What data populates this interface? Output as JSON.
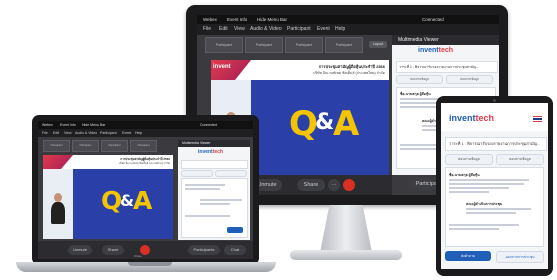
{
  "monitor": {
    "title": {
      "app": "Webex",
      "event_info": "Event Info",
      "hide_menu": "Hide Menu Bar",
      "connected": "Connected"
    },
    "menu": [
      "File",
      "Edit",
      "View",
      "Audio & Video",
      "Participant",
      "Event",
      "Help"
    ],
    "layout_label": "Layout",
    "thumbs": [
      "Participant",
      "Participant",
      "Participant",
      "Participant"
    ],
    "slide_heading": "การประชุมสามัญผู้ถือหุ้นประจำปี 2566",
    "slide_sub": "บริษัท อินเวนท์เทค ซิสเต็มส์ (ประเทศไทย) จำกัด",
    "qa_q": "Q",
    "qa_amp": "&",
    "qa_a": "A",
    "unmute": "Unmute",
    "share": "Share",
    "more": "···",
    "participants": "Participants",
    "panel_title": "Multimedia Viewer",
    "logo_a": "invent",
    "logo_b": "tech",
    "agenda_label": "วาระที่ 1 : พิจารณารับรองรายงานการประชุมสามัญ...",
    "tab_left": "สอบถามข้อมูล",
    "tab_right": "สอบถามข้อมูล",
    "qa_user": "ชื่อ-นามสกุล ผู้ถือหุ้น",
    "reply_user": "คณะผู้ดำเนินการประชุม",
    "send": "ส่ง"
  },
  "laptop": {
    "title": {
      "app": "Webex",
      "event_info": "Event Info",
      "hide_menu": "Hide Menu Bar",
      "connected": "Connected"
    },
    "menu": [
      "File",
      "Edit",
      "View",
      "Audio & Video",
      "Participant",
      "Event",
      "Help"
    ],
    "thumbs": [
      "Participant",
      "Participant",
      "Participant",
      "Participant"
    ],
    "slide_heading": "การประชุมสามัญผู้ถือหุ้นประจำปี 2566",
    "slide_sub": "บริษัท อินเวนท์เทค ซิสเต็มส์ (ประเทศไทย) จำกัด",
    "qa_q": "Q",
    "qa_amp": "&",
    "qa_a": "A",
    "unmute": "Unmute",
    "share": "Share",
    "participants": "Participants",
    "chat": "Chat",
    "panel_title": "Multimedia Viewer",
    "logo_a": "invent",
    "logo_b": "tech",
    "bottom_label": "Close"
  },
  "tablet": {
    "logo_a": "invent",
    "logo_b": "tech",
    "agenda_label": "วาระที่ 1 : พิจารณารับรองรายงานการประชุมสามัญ...",
    "tab_left": "สอบถามข้อมูล",
    "tab_right": "สอบถามข้อมูล",
    "q_name": "ชื่อ-นามสกุล ผู้ถือหุ้น",
    "reply_name": "คณะผู้ดำเนินการประชุม",
    "btn_left": "ส่งคำถาม",
    "btn_right": "ออกจากการประชุม"
  },
  "colors": {
    "accent_red": "#d93025",
    "qa_blue": "#2a3fa8",
    "qa_yellow": "#f2c500",
    "brand_blue": "#1f5fb8",
    "brand_red": "#e23b4a"
  }
}
